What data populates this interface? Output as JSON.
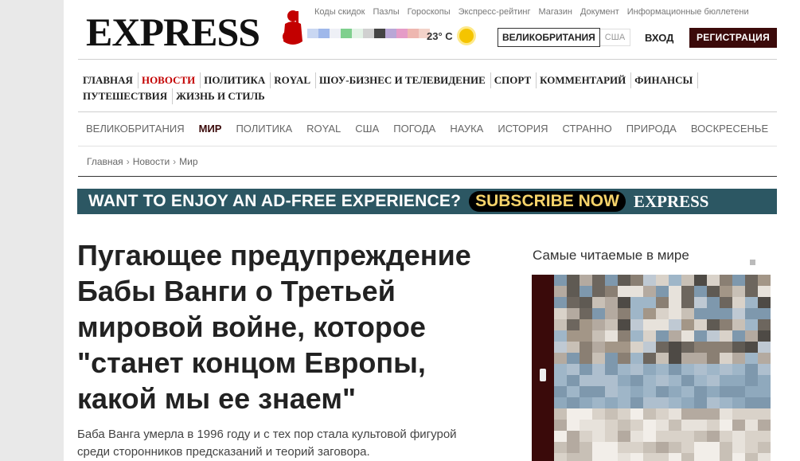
{
  "header": {
    "logo": "EXPRESS",
    "top_links": [
      "Коды скидок",
      "Пазлы",
      "Гороскопы",
      "Экспресс-рейтинг",
      "Магазин",
      "Документ",
      "Информационные бюллетени"
    ],
    "weather": {
      "temp": "23° C",
      "icon": "sun-icon"
    },
    "edition": {
      "selected": "ВЕЛИКОБРИТАНИЯ",
      "other": "США"
    },
    "login_label": "ВХОД",
    "register_label": "РЕГИСТРАЦИЯ"
  },
  "primary_nav": {
    "items": [
      "ГЛАВНАЯ",
      "НОВОСТИ",
      "ПОЛИТИКА",
      "ROYAL",
      "ШОУ-БИЗНЕС И ТЕЛЕВИДЕНИЕ",
      "СПОРТ",
      "КОММЕНТАРИЙ",
      "ФИНАНСЫ",
      "ПУТЕШЕСТВИЯ",
      "ЖИЗНЬ И СТИЛЬ"
    ],
    "active": "НОВОСТИ"
  },
  "secondary_nav": {
    "items": [
      "ВЕЛИКОБРИТАНИЯ",
      "МИР",
      "ПОЛИТИКА",
      "ROYAL",
      "США",
      "ПОГОДА",
      "НАУКА",
      "ИСТОРИЯ",
      "СТРАННО",
      "ПРИРОДА",
      "ВОСКРЕСЕНЬЕ"
    ],
    "active": "МИР"
  },
  "breadcrumb": [
    "Главная",
    "Новости",
    "Мир"
  ],
  "banner": {
    "text": "WANT TO ENJOY AN AD-FREE EXPERIENCE?",
    "cta": "SUBSCRIBE NOW",
    "logo": "EXPRESS"
  },
  "article": {
    "headline": "Пугающее предупреждение Бабы Ванги о Третьей мировой войне, которое \"станет концом Европы, какой мы ее знаем\"",
    "standfirst": "Баба Ванга умерла в 1996 году и с тех пор стала культовой фигурой среди сторонников предсказаний и теорий заговора."
  },
  "sidebar": {
    "title": "Самые читаемые в мире"
  },
  "colors": {
    "brand_dark": "#3b0a0a",
    "active_red": "#c30000",
    "banner_bg": "#2c5763",
    "cta_yellow": "#f6d36a"
  }
}
